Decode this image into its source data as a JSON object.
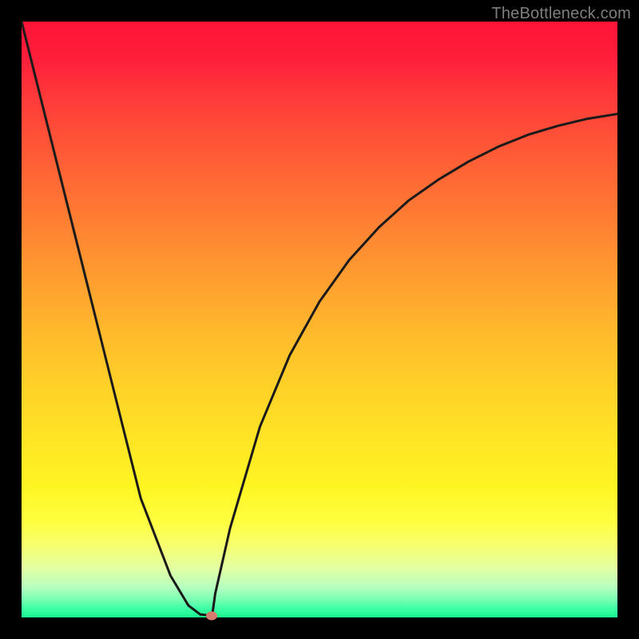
{
  "watermark": "TheBottleneck.com",
  "chart_data": {
    "type": "line",
    "title": "",
    "xlabel": "",
    "ylabel": "",
    "xlim": [
      0,
      100
    ],
    "ylim": [
      0,
      100
    ],
    "grid": false,
    "series": [
      {
        "name": "curve",
        "x": [
          0,
          5,
          10,
          15,
          20,
          25,
          28,
          30,
          31,
          32,
          32.5,
          35,
          40,
          45,
          50,
          55,
          60,
          65,
          70,
          75,
          80,
          85,
          90,
          95,
          100
        ],
        "values": [
          100,
          80,
          60,
          40,
          20,
          7,
          2,
          0.5,
          0.4,
          0.4,
          4,
          15,
          32,
          44,
          53,
          60,
          65.5,
          70,
          73.5,
          76.5,
          79,
          81,
          82.5,
          83.7,
          84.5
        ]
      }
    ],
    "marker": {
      "x": 31.9,
      "y": 0.3
    },
    "background_gradient": [
      "#ff1437",
      "#ff3b3a",
      "#ff7a33",
      "#ffb92c",
      "#ffe425",
      "#feff40",
      "#e0ffa6",
      "#7affb3",
      "#18f58e"
    ]
  }
}
